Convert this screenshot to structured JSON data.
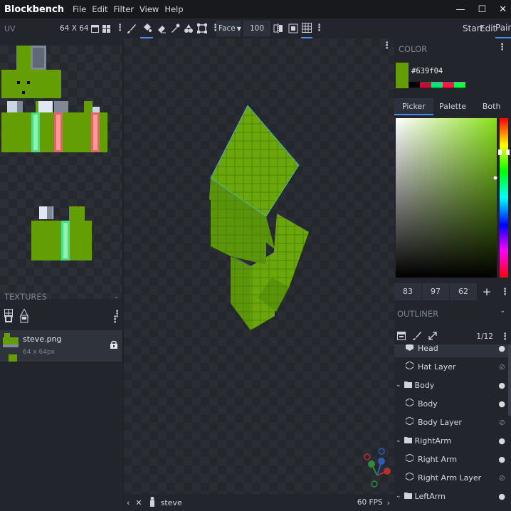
{
  "app": {
    "name": "Blockbench"
  },
  "menu": [
    "File",
    "Edit",
    "Filter",
    "View",
    "Help"
  ],
  "window_controls": {
    "minimize": "—",
    "maximize": "☐",
    "close": "✕"
  },
  "toolbar": {
    "uv_label": "UV",
    "uv_size": "64 X 64",
    "face_select": "Face",
    "brush_size": "100",
    "modes": [
      "Start",
      "Edit",
      "Paint"
    ],
    "active_mode": "Paint"
  },
  "textures": {
    "title": "TEXTURES",
    "items": [
      {
        "name": "steve.png",
        "size": "64 x 64px"
      }
    ]
  },
  "color": {
    "title": "COLOR",
    "hex": "#639f04",
    "current": "#639f04",
    "swatches": [
      "#000000",
      "#c0102c",
      "#00e676",
      "#ff1744",
      "#00ff44"
    ],
    "tabs": [
      "Picker",
      "Palette",
      "Both"
    ],
    "active_tab": "Picker",
    "rgb": {
      "r": "83",
      "g": "97",
      "b": "62"
    },
    "add": "+"
  },
  "outliner": {
    "title": "OUTLINER",
    "count": "1/12",
    "items": [
      {
        "label": "Head",
        "type": "cube"
      },
      {
        "label": "Hat Layer",
        "type": "cube"
      },
      {
        "label": "Body",
        "type": "group"
      },
      {
        "label": "Body",
        "type": "cube"
      },
      {
        "label": "Body Layer",
        "type": "cube"
      },
      {
        "label": "RightArm",
        "type": "group"
      },
      {
        "label": "Right Arm",
        "type": "cube"
      },
      {
        "label": "Right Arm Layer",
        "type": "cube"
      },
      {
        "label": "LeftArm",
        "type": "group"
      }
    ]
  },
  "status": {
    "model_name": "steve",
    "fps": "60 FPS"
  },
  "colors": {
    "accent": "#3e90ff",
    "skin_green": "#639f04"
  }
}
